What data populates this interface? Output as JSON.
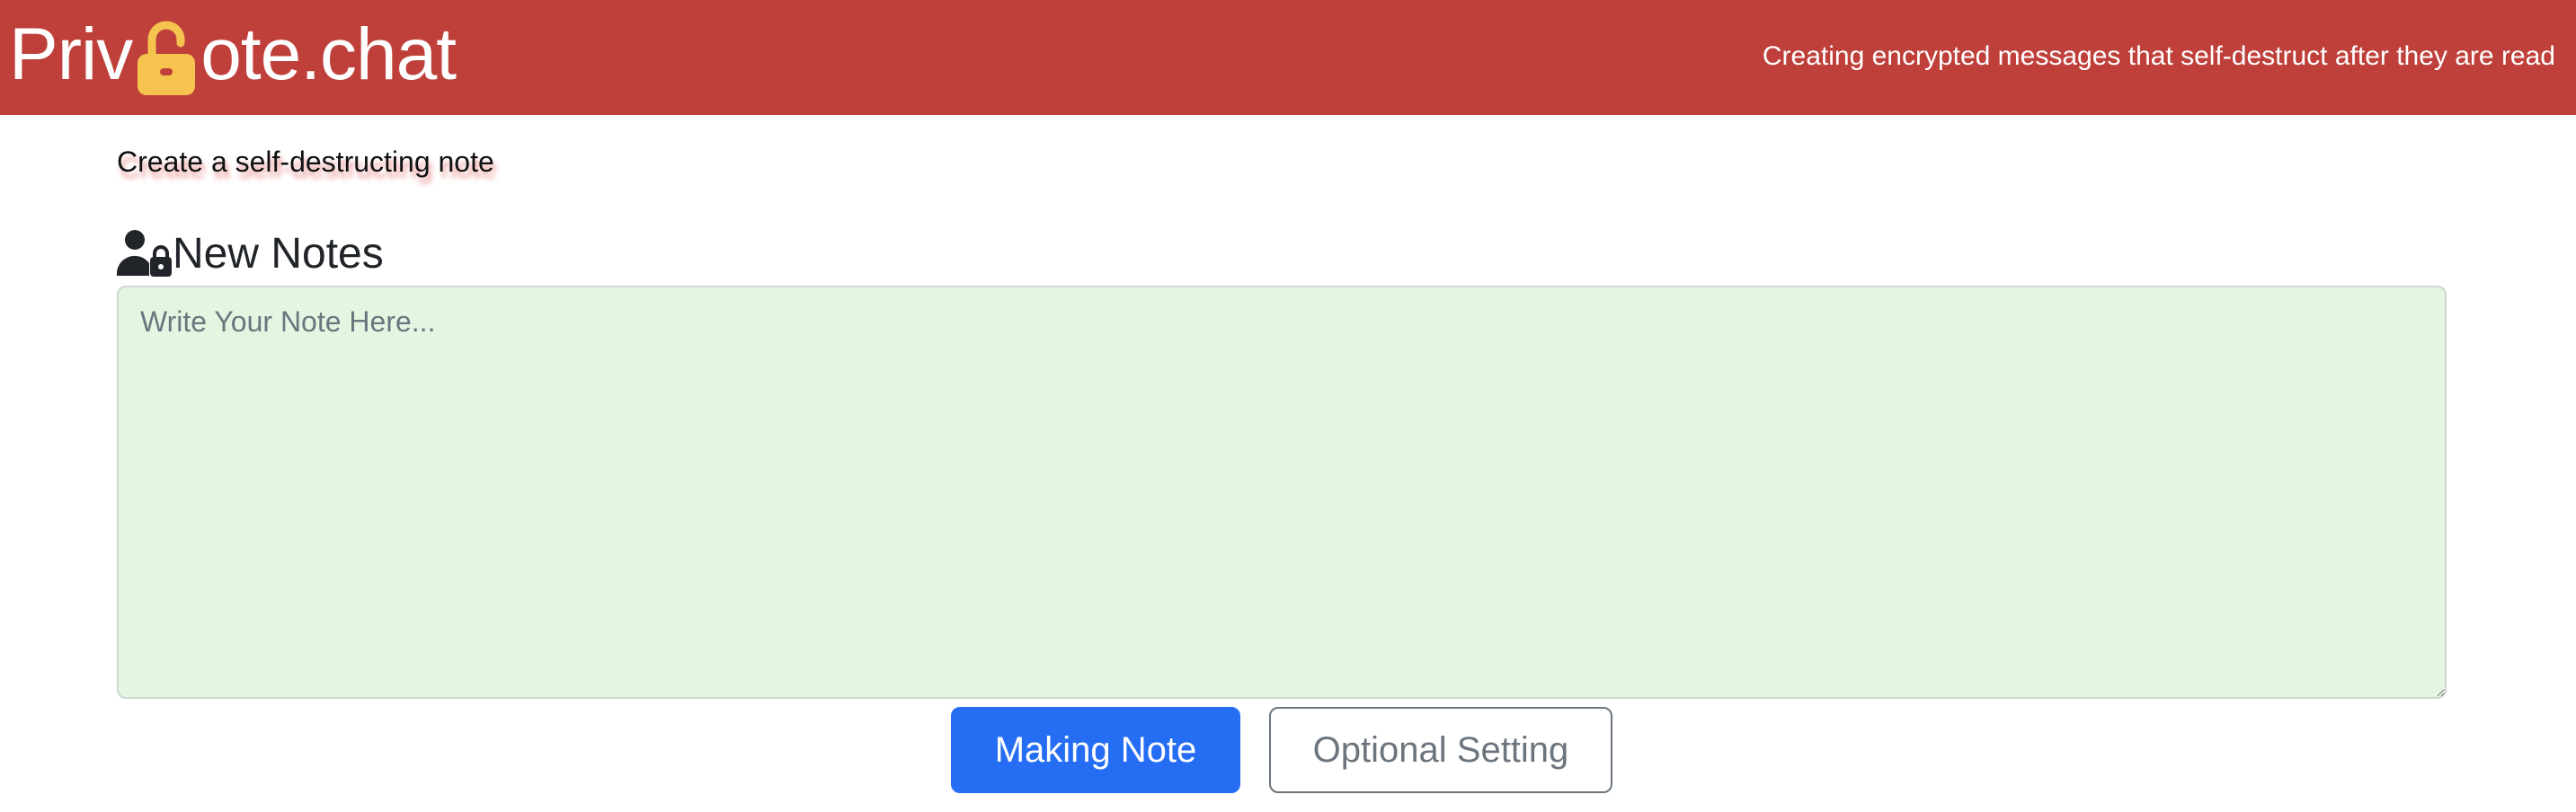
{
  "header": {
    "logo_prefix": "Priv",
    "logo_suffix": "ote.chat",
    "logo_icon": "unlocked-padlock-icon",
    "tagline": "Creating encrypted messages that self-destruct after they are read",
    "colors": {
      "background": "#bf403b",
      "lock": "#f6c34f"
    }
  },
  "main": {
    "subtitle": "Create a self-destructing note",
    "notes_heading": "New Notes",
    "notes_icon": "user-lock-icon",
    "note_input": {
      "value": "",
      "placeholder": "Write Your Note Here..."
    },
    "buttons": {
      "make_note": "Making Note",
      "optional_setting": "Optional Setting"
    },
    "colors": {
      "textarea_bg": "#e4f6e1",
      "primary": "#256ef4",
      "secondary": "#6c757d"
    }
  }
}
